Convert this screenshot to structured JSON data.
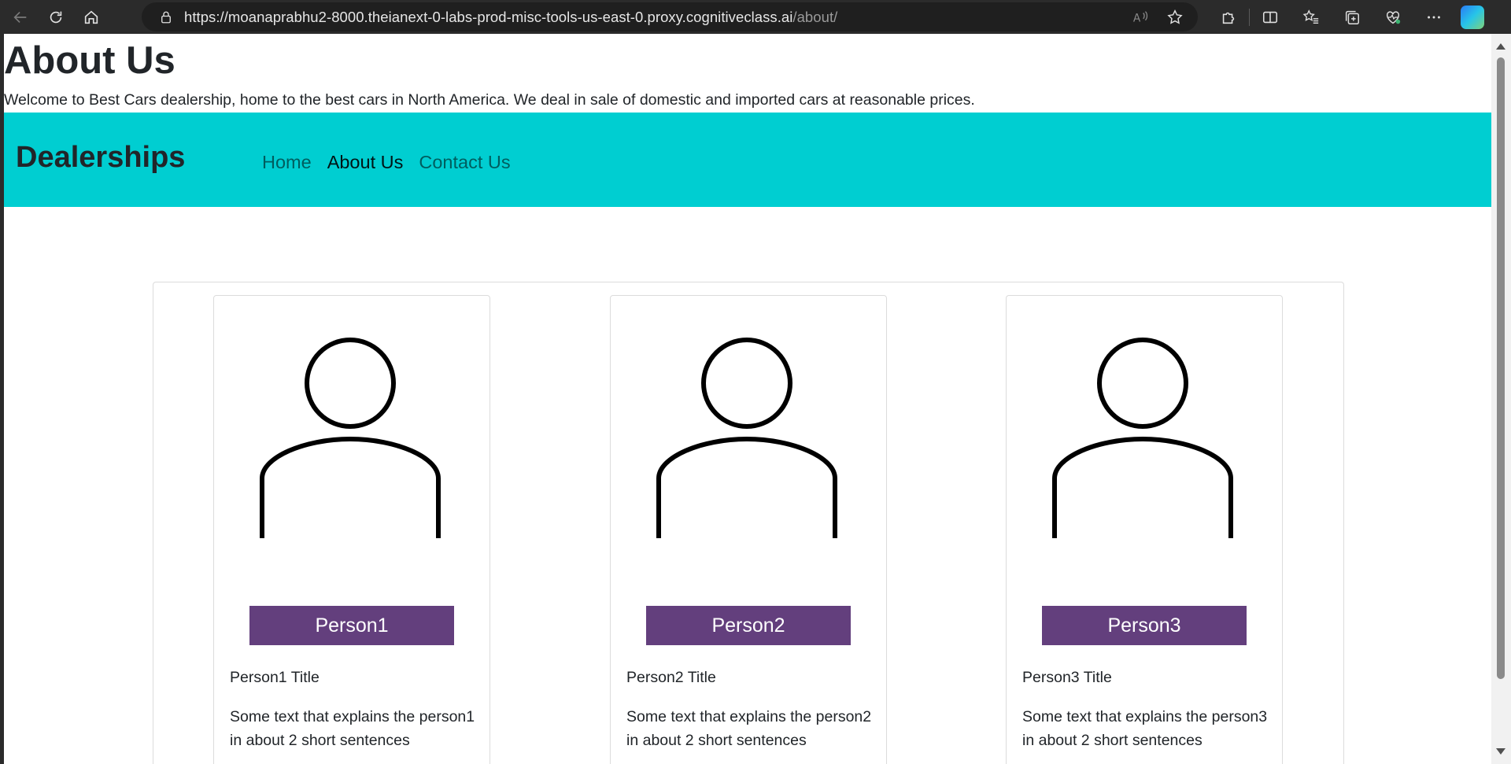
{
  "browser": {
    "url_main": "https://moanaprabhu2-8000.theianext-0-labs-prod-misc-tools-us-east-0.proxy.cognitiveclass.ai",
    "url_path": "/about/"
  },
  "page": {
    "title": "About Us",
    "intro": "Welcome to Best Cars dealership, home to the best cars in North America. We deal in sale of domestic and imported cars at reasonable prices."
  },
  "navbar": {
    "brand": "Dealerships",
    "links": [
      "Home",
      "About Us",
      "Contact Us"
    ],
    "active": "About Us",
    "background": "#00ced1"
  },
  "people": [
    {
      "name": "Person1",
      "title": "Person1 Title",
      "text": "Some text that explains the person1 in about 2 short sentences"
    },
    {
      "name": "Person2",
      "title": "Person2 Title",
      "text": "Some text that explains the person2 in about 2 short sentences"
    },
    {
      "name": "Person3",
      "title": "Person3 Title",
      "text": "Some text that explains the person3 in about 2 short sentences"
    }
  ],
  "colors": {
    "name_button": "#633f7d"
  }
}
